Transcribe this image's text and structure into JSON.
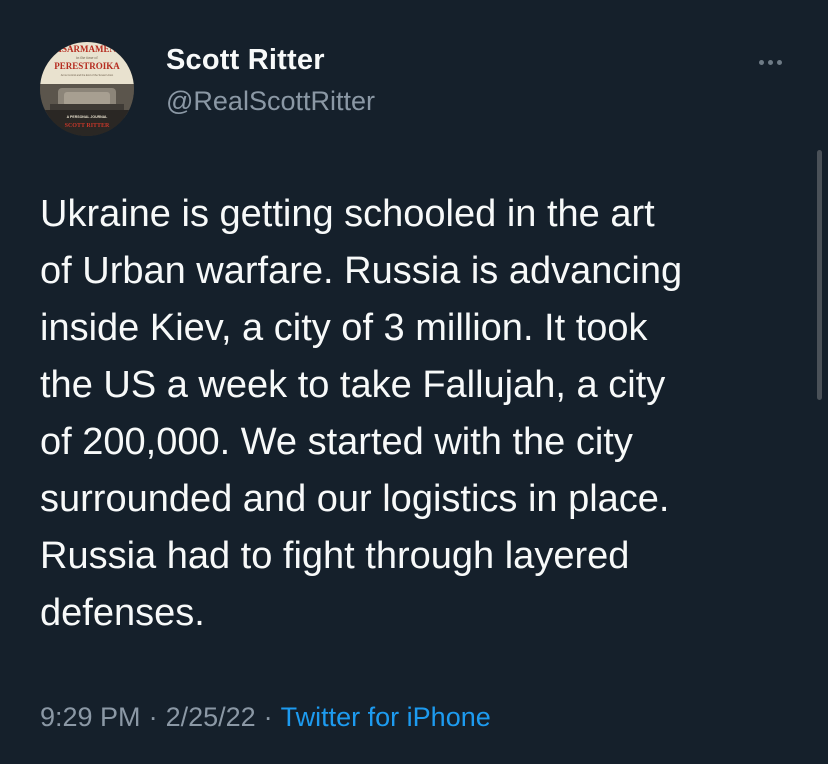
{
  "tweet": {
    "author": {
      "display_name": "Scott Ritter",
      "handle": "@RealScottRitter",
      "avatar": {
        "title_top": "DISARMAMENT",
        "title_mid": "in the time of",
        "title_main": "PERESTROIKA",
        "subtitle": "Arms Control and the End of the Soviet Union",
        "caption": "A PERSONAL JOURNAL",
        "author_name": "SCOTT RITTER"
      }
    },
    "more_icon": "more-horizontal-icon",
    "text_lines": [
      "Ukraine is getting schooled in the art",
      "of Urban warfare. Russia is advancing",
      "inside Kiev, a city of 3 million. It took",
      "the US a week to take Fallujah, a city",
      "of 200,000. We started with the city",
      "surrounded and our logistics in place.",
      "Russia had to fight through layered",
      "defenses."
    ],
    "time": "9:29 PM",
    "date": "2/25/22",
    "separator": "·",
    "source": "Twitter for iPhone"
  },
  "colors": {
    "background": "#15202b",
    "text": "#f7f9f9",
    "secondary": "#8b98a5",
    "link": "#1d9bf0"
  }
}
